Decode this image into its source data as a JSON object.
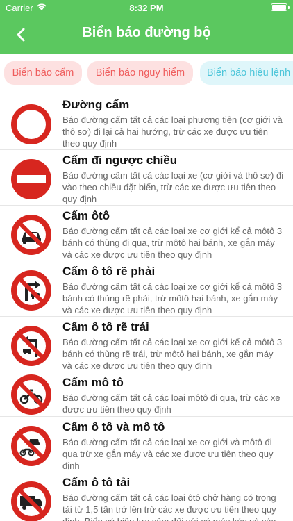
{
  "status_bar": {
    "carrier": "Carrier",
    "time": "8:32 PM"
  },
  "nav": {
    "title": "Biển báo đường bộ",
    "back_icon": "chevron-left-icon"
  },
  "tabs": [
    {
      "label": "Biển báo cấm"
    },
    {
      "label": "Biển báo nguy hiểm"
    },
    {
      "label": "Biển báo hiệu lệnh"
    }
  ],
  "colors": {
    "header": "#5bc85f",
    "sign_red": "#d7261f",
    "tab_red_bg": "#fde1e1",
    "tab_red_text": "#ef5d5d",
    "tab_cyan_bg": "#dff6fa",
    "tab_cyan_text": "#4cc5d9"
  },
  "signs": [
    {
      "title": "Đường cấm",
      "icon": "no-entry-both-directions-icon",
      "description": "Báo đường cấm tất cả các loại phương tiện (cơ giới và thô sơ) đi lại cả hai hướng, trừ các xe được ưu tiên theo quy định"
    },
    {
      "title": "Cấm đi ngược chiều",
      "icon": "no-entry-icon",
      "description": "Báo đường cấm tất cả các loại xe (cơ giới và thô sơ) đi vào theo chiều đặt biển, trừ các xe được ưu tiên theo quy định"
    },
    {
      "title": "Cấm ôtô",
      "icon": "no-cars-icon",
      "description": "Báo đường cấm tất cả các loại xe cơ giới kể cả môtô 3 bánh có thùng đi qua, trừ môtô hai bánh, xe gắn máy và các xe được ưu tiên theo quy định"
    },
    {
      "title": "Cấm ô tô rẽ phải",
      "icon": "no-right-turn-car-icon",
      "description": "Báo đường cấm tất cả các loại xe cơ giới kể cả môtô 3 bánh có thùng rẽ phải, trừ môtô hai bánh, xe gắn máy và các xe được ưu tiên theo quy định"
    },
    {
      "title": "Cấm ô tô rẽ trái",
      "icon": "no-left-turn-car-icon",
      "description": "Báo đường cấm tất cả các loại xe cơ giới kể cả môtô 3 bánh có thùng rẽ trái, trừ môtô hai bánh, xe gắn máy và các xe được ưu tiên theo quy định"
    },
    {
      "title": "Cấm mô tô",
      "icon": "no-motorcycles-icon",
      "description": "Báo đường cấm tất cả các loại môtô đi qua, trừ các xe được ưu tiên theo quy định"
    },
    {
      "title": "Cấm ô tô và mô tô",
      "icon": "no-cars-and-motorcycles-icon",
      "description": "Báo đường cấm tất cả các loại xe cơ giới và môtô đi qua trừ xe gắn máy và các xe được ưu tiên theo quy định"
    },
    {
      "title": "Cấm ô tô tải",
      "icon": "no-trucks-icon",
      "description": "Báo đường cấm tất cả các loại ôtô chở hàng có trọng tải từ 1,5 tấn trở lên trừ các xe được ưu tiên theo quy định. Biển có hiệu lực cấm đối với cả máy kéo và các"
    }
  ]
}
